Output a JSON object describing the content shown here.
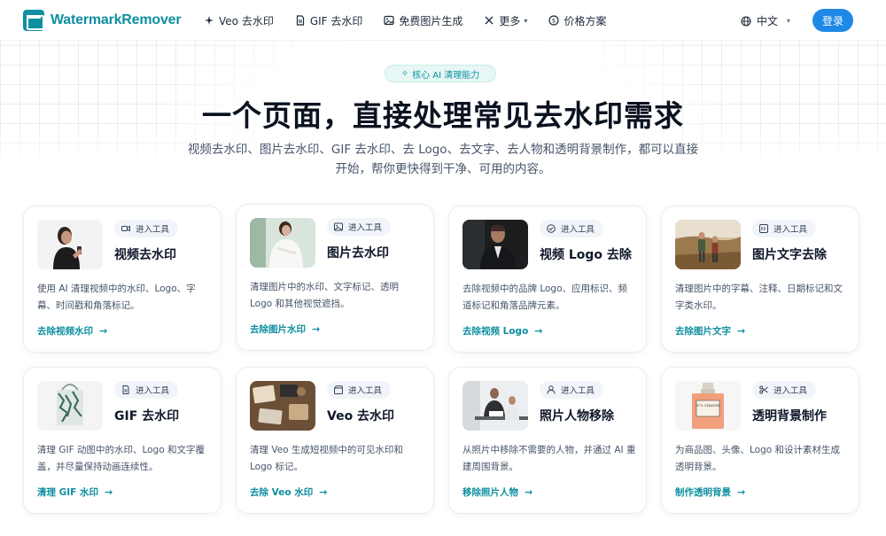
{
  "nav": {
    "brand": "WatermarkRemover",
    "links": [
      {
        "label": "Veo 去水印",
        "icon": "sparkle-icon"
      },
      {
        "label": "GIF 去水印",
        "icon": "file-icon"
      },
      {
        "label": "免费图片生成",
        "icon": "image-icon"
      },
      {
        "label": "更多",
        "icon": "tools-icon"
      },
      {
        "label": "价格方案",
        "icon": "dollar-icon"
      }
    ],
    "language": "中文",
    "login": "登录"
  },
  "hero": {
    "badge": "核心 AI 清理能力",
    "title": "一个页面，直接处理常见去水印需求",
    "subtitle_line1": "视频去水印、图片去水印、GIF 去水印、去 Logo、去文字、去人物和透明背景制作，都可以直接",
    "subtitle_line2": "开始，帮你更快得到干净、可用的内容。"
  },
  "cards": [
    {
      "tag": "进入工具",
      "title": "视频去水印",
      "desc": "使用 AI 清理视频中的水印、Logo、字幕、时间戳和角落标记。",
      "link": "去除视频水印",
      "icon": "video-icon"
    },
    {
      "tag": "进入工具",
      "title": "图片去水印",
      "desc": "清理图片中的水印、文字标记、透明 Logo 和其他视觉遮挡。",
      "link": "去除图片水印",
      "icon": "image-icon"
    },
    {
      "tag": "进入工具",
      "title": "视频 Logo 去除",
      "desc": "去除视频中的品牌 Logo、应用标识、频道标记和角落品牌元素。",
      "link": "去除视频 Logo",
      "icon": "check-circle-icon"
    },
    {
      "tag": "进入工具",
      "title": "图片文字去除",
      "desc": "清理图片中的字幕、注释、日期标记和文字类水印。",
      "link": "去除图片文字",
      "icon": "text-box-icon"
    },
    {
      "tag": "进入工具",
      "title": "GIF 去水印",
      "desc": "清理 GIF 动图中的水印、Logo 和文字覆盖，并尽量保持动画连续性。",
      "link": "清理 GIF 水印",
      "icon": "file-icon"
    },
    {
      "tag": "进入工具",
      "title": "Veo 去水印",
      "desc": "清理 Veo 生成短视频中的可见水印和 Logo 标记。",
      "link": "去除 Veo 水印",
      "icon": "clapper-icon"
    },
    {
      "tag": "进入工具",
      "title": "照片人物移除",
      "desc": "从照片中移除不需要的人物，并通过 AI 重建周围背景。",
      "link": "移除照片人物",
      "icon": "user-icon"
    },
    {
      "tag": "进入工具",
      "title": "透明背景制作",
      "desc": "为商品图、头像、Logo 和设计素材生成透明背景。",
      "link": "制作透明背景",
      "icon": "scissors-icon"
    }
  ],
  "thumb_labels": {
    "perfume": "N°5 CHANEL"
  },
  "colors": {
    "brand": "#0f8fa0",
    "login": "#1e88e5",
    "title": "#0b1220",
    "text": "#475569"
  }
}
